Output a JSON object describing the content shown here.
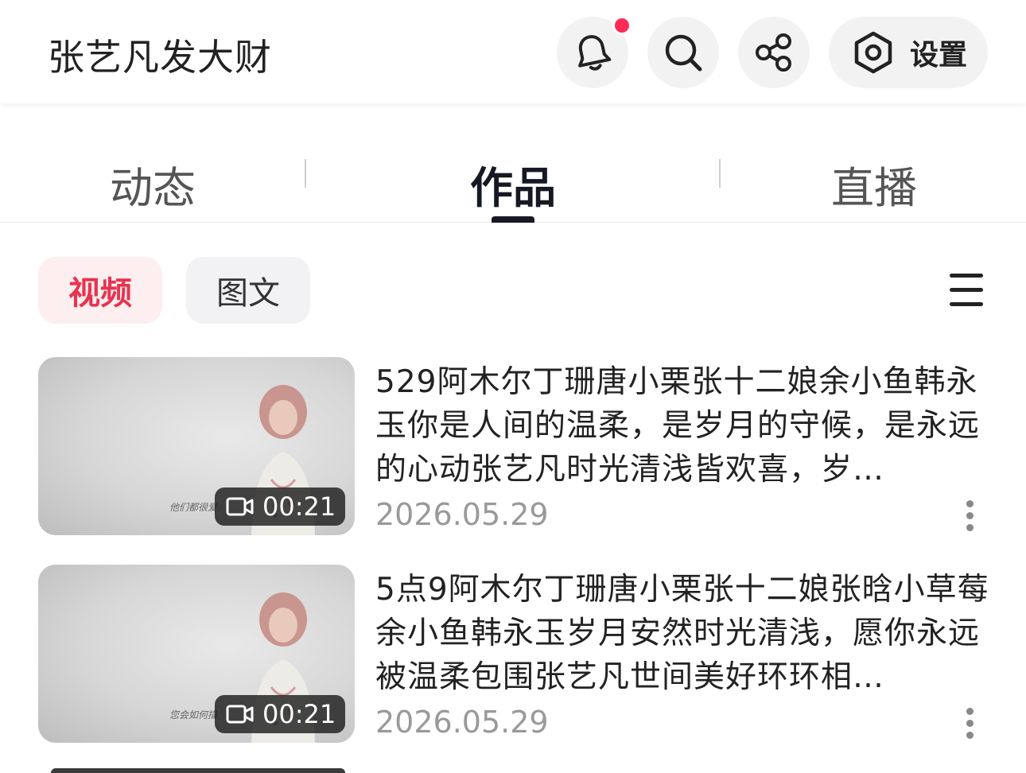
{
  "header": {
    "title": "张艺凡发大财",
    "notification_icon": "bell-icon",
    "notification_badge_color": "#fe2c55",
    "search_icon": "search-icon",
    "share_icon": "share-icon",
    "settings_label": "设置",
    "settings_icon": "hexagon-settings-icon"
  },
  "tabs": [
    {
      "label": "动态",
      "active": false
    },
    {
      "label": "作品",
      "active": true
    },
    {
      "label": "直播",
      "active": false
    }
  ],
  "filters": {
    "video_label": "视频",
    "tuwen_label": "图文",
    "active": "视频",
    "accent_color": "#e8334e",
    "menu_icon": "list-menu-icon"
  },
  "videos": [
    {
      "title": "529阿木尔丁珊唐小栗张十二娘余小鱼韩永玉你是人间的温柔，是岁月的守候，是永远的心动张艺凡时光清浅皆欢喜，岁…",
      "date": "2026.05.29",
      "duration": "00:21",
      "thumb_caption": "他们都很爱"
    },
    {
      "title": "5点9阿木尔丁珊唐小栗张十二娘张晗小草莓余小鱼韩永玉岁月安然时光清浅，愿你永远被温柔包围张艺凡世间美好环环相…",
      "date": "2026.05.29",
      "duration": "00:21",
      "thumb_caption": "您会如何描"
    }
  ]
}
